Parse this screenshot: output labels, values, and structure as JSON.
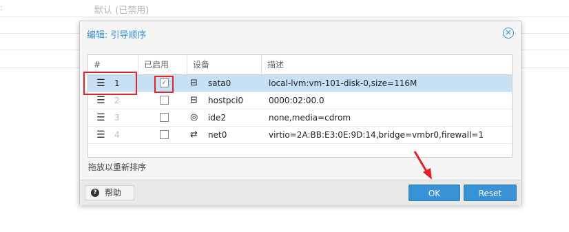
{
  "background": {
    "row1_text": "默认 (已禁用)",
    "row1_colon": ":"
  },
  "dialog": {
    "title": "编辑: 引导顺序",
    "close_icon": "close-circle-icon",
    "columns": [
      "#",
      "已启用",
      "设备",
      "描述"
    ],
    "rows": [
      {
        "order": "1",
        "enabled": true,
        "device_icon": "hdd-icon",
        "device": "sata0",
        "description": "local-lvm:vm-101-disk-0,size=116M"
      },
      {
        "order": "2",
        "enabled": false,
        "device_icon": "hdd-icon",
        "device": "hostpci0",
        "description": "0000:02:00.0"
      },
      {
        "order": "3",
        "enabled": false,
        "device_icon": "cdrom-icon",
        "device": "ide2",
        "description": "none,media=cdrom"
      },
      {
        "order": "4",
        "enabled": false,
        "device_icon": "network-exchange-icon",
        "device": "net0",
        "description": "virtio=2A:BB:E3:0E:9D:14,bridge=vmbr0,firewall=1"
      }
    ],
    "hint": "拖放以重新排序",
    "help_label": "帮助",
    "ok_label": "OK",
    "reset_label": "Reset"
  },
  "colors": {
    "accent": "#3892d4",
    "selected_row": "#c8e0f4",
    "highlight": "#d9292f"
  }
}
